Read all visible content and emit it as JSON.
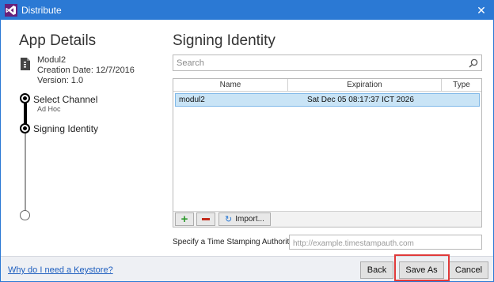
{
  "window": {
    "title": "Distribute",
    "close_glyph": "✕"
  },
  "left": {
    "heading": "App Details",
    "app_name": "Modul2",
    "creation_date": "Creation Date: 12/7/2016",
    "version": "Version: 1.0",
    "steps": [
      {
        "label": "Select Channel",
        "sub": "Ad Hoc"
      },
      {
        "label": "Signing Identity",
        "sub": ""
      }
    ]
  },
  "right": {
    "heading": "Signing Identity",
    "search": {
      "placeholder": "Search",
      "value": ""
    },
    "columns": [
      "Name",
      "Expiration",
      "Type"
    ],
    "rows": [
      {
        "name": "modul2",
        "expiration": "Sat Dec 05 08:17:37 ICT 2026",
        "type": ""
      }
    ],
    "toolbar": {
      "add_glyph": "+",
      "import_label": "Import..."
    },
    "tsa": {
      "label": "Specify a Time Stamping Authority:",
      "placeholder": "http://example.timestampauth.com"
    }
  },
  "footer": {
    "help_link": "Why do I need a Keystore?",
    "back_label": "Back",
    "save_as_label": "Save As",
    "cancel_label": "Cancel"
  },
  "colors": {
    "titlebar": "#2b79d4",
    "selection": "#c9e4f6",
    "highlight": "#e03a3a",
    "link": "#1f5fbf"
  },
  "icons": [
    "visual-studio-icon",
    "close-icon",
    "document-icon",
    "search-icon",
    "add-icon",
    "remove-icon",
    "import-icon"
  ]
}
